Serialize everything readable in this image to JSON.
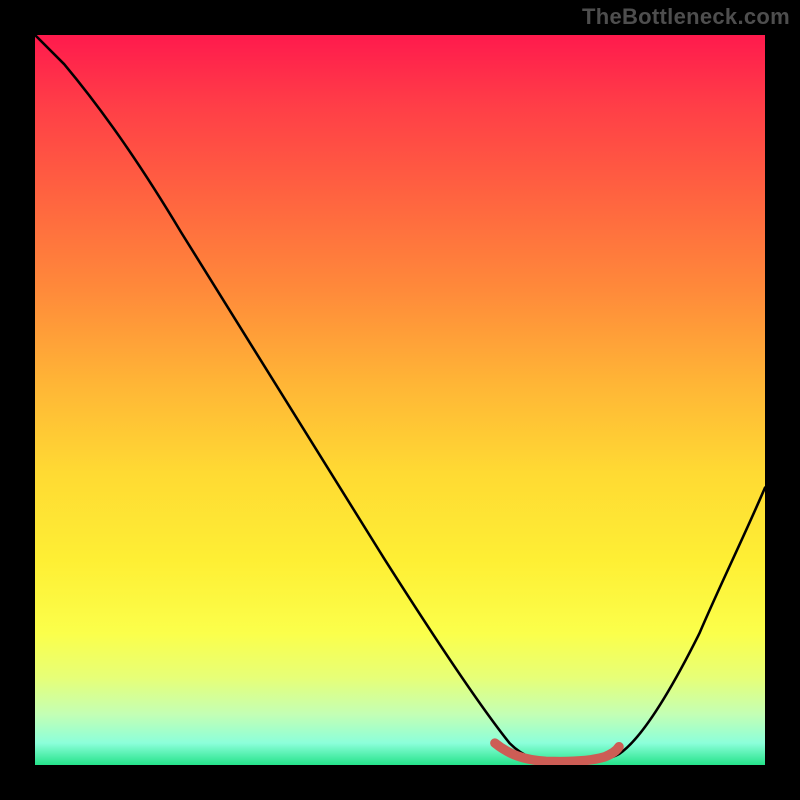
{
  "watermark": "TheBottleneck.com",
  "chart_data": {
    "type": "line",
    "title": "",
    "xlabel": "",
    "ylabel": "",
    "xlim": [
      0,
      100
    ],
    "ylim": [
      0,
      100
    ],
    "grid": false,
    "legend": false,
    "background_gradient_stops": [
      {
        "pos": 0,
        "color": "#ff1a4d"
      },
      {
        "pos": 10,
        "color": "#ff3f47"
      },
      {
        "pos": 22,
        "color": "#ff6340"
      },
      {
        "pos": 35,
        "color": "#ff8a3a"
      },
      {
        "pos": 48,
        "color": "#ffb636"
      },
      {
        "pos": 60,
        "color": "#ffda33"
      },
      {
        "pos": 72,
        "color": "#feef34"
      },
      {
        "pos": 82,
        "color": "#fbff4b"
      },
      {
        "pos": 88,
        "color": "#e7ff77"
      },
      {
        "pos": 93,
        "color": "#c4ffb4"
      },
      {
        "pos": 97,
        "color": "#8cffda"
      },
      {
        "pos": 100,
        "color": "#25e38a"
      }
    ],
    "series": [
      {
        "name": "bottleneck-curve",
        "color": "#000000",
        "x": [
          0,
          3,
          8,
          15,
          25,
          35,
          45,
          55,
          62,
          68,
          72,
          78,
          82,
          88,
          94,
          100
        ],
        "values": [
          100,
          97,
          91,
          82,
          67,
          52,
          37,
          22,
          11,
          3,
          0,
          0,
          3,
          12,
          24,
          38
        ]
      }
    ],
    "highlight_segment": {
      "name": "optimal-range",
      "color": "#cd5d55",
      "x": [
        63,
        66,
        70,
        74,
        78,
        80
      ],
      "values": [
        3,
        1.5,
        0.5,
        0.5,
        1.2,
        2.5
      ]
    }
  }
}
